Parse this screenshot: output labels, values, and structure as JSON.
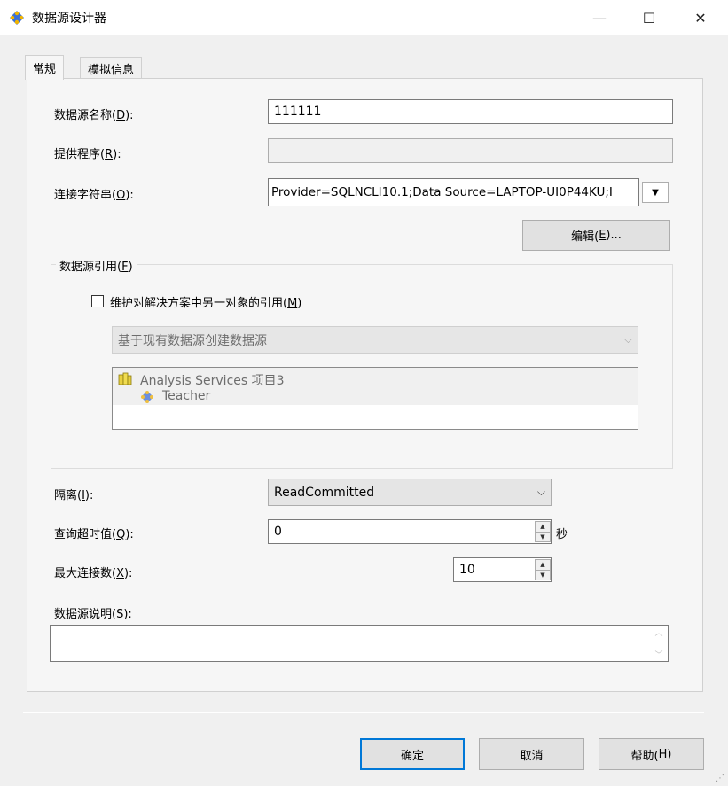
{
  "window": {
    "title": "数据源设计器",
    "minimize": "—",
    "maximize": "☐",
    "close": "✕"
  },
  "tabs": [
    {
      "label": "常规",
      "active": true
    },
    {
      "label": "模拟信息",
      "active": false
    }
  ],
  "fields": {
    "name": {
      "label": "数据源名称(",
      "key": "D",
      "suffix": "):",
      "value": "111111"
    },
    "provider": {
      "label": "提供程序(",
      "key": "R",
      "suffix": "):",
      "value": ""
    },
    "connection": {
      "label": "连接字符串(",
      "key": "O",
      "suffix": "):",
      "value": "Provider=SQLNCLI10.1;Data Source=LAPTOP-UI0P44KU;I"
    },
    "edit_button": {
      "label": "编辑(",
      "key": "E",
      "suffix": ")..."
    }
  },
  "reference": {
    "group_label": "数据源引用(",
    "group_key": "F",
    "group_suffix": ")",
    "checkbox": {
      "label": "维护对解决方案中另一对象的引用(",
      "key": "M",
      "suffix": ")",
      "checked": false
    },
    "combo_value": "基于现有数据源创建数据源",
    "tree": {
      "project": "Analysis Services 项目3",
      "child": "Teacher"
    }
  },
  "options": {
    "isolation": {
      "label": "隔离(",
      "key": "I",
      "suffix": "):",
      "value": "ReadCommitted"
    },
    "timeout": {
      "label": "查询超时值(",
      "key": "Q",
      "suffix": "):",
      "value": "0",
      "unit": "秒"
    },
    "max_conn": {
      "label": "最大连接数(",
      "key": "X",
      "suffix": "):",
      "value": "10"
    },
    "description": {
      "label": "数据源说明(",
      "key": "S",
      "suffix": "):",
      "value": ""
    }
  },
  "buttons": {
    "ok": "确定",
    "cancel": "取消",
    "help_label": "帮助(",
    "help_key": "H",
    "help_suffix": ")"
  }
}
